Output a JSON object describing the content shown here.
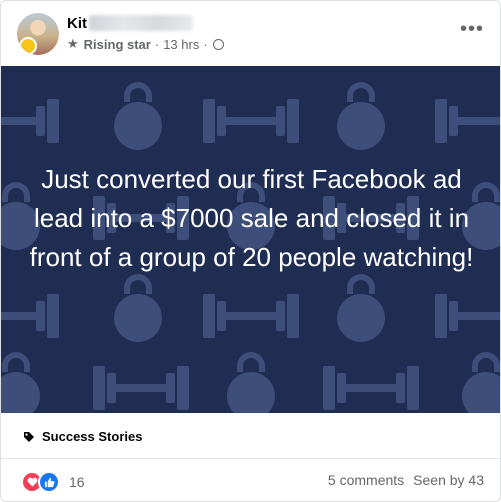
{
  "post": {
    "author_first_name": "Kit",
    "author_rank": "Rising star",
    "time": "13 hrs",
    "dot": "·",
    "more_glyph": "•••"
  },
  "image": {
    "text": "Just converted our first Facebook ad lead into a $7000 sale and closed it in front of a group of 20 people watching!",
    "colors": {
      "background": "#1f2d52",
      "pattern": "#3e4e7a"
    }
  },
  "topic": {
    "label": "Success Stories",
    "icon": "tag-icon"
  },
  "footer": {
    "reaction_icons": [
      "love-icon",
      "like-icon"
    ],
    "reaction_count": "16",
    "comments": "5 comments",
    "seen": "Seen by 43"
  }
}
